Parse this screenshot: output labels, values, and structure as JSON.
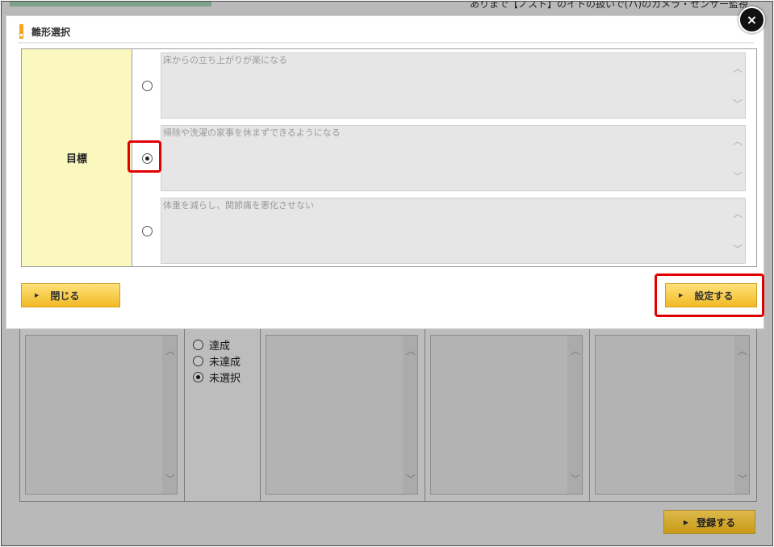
{
  "background": {
    "header_text": "ありまで【ノスト】のイトの扱いで(ハ)のカメラ・センサー監視",
    "status_options": [
      {
        "label": "達成",
        "selected": false
      },
      {
        "label": "未達成",
        "selected": false
      },
      {
        "label": "未選択",
        "selected": true
      }
    ],
    "register_label": "登録する"
  },
  "modal": {
    "title": "雛形選択",
    "close_icon": "×",
    "goal_label": "目標",
    "options": [
      {
        "text": "床からの立ち上がりが楽になる",
        "selected": false
      },
      {
        "text": "掃除や洗濯の家事を休まずできるようになる",
        "selected": true
      },
      {
        "text": "体重を減らし、関節痛を悪化させない",
        "selected": false
      }
    ],
    "close_label": "閉じる",
    "set_label": "設定する"
  },
  "colors": {
    "accent": "#f5a623",
    "button_gold": "#f2b925",
    "label_cell": "#faf7bf",
    "highlight": "#e00000"
  }
}
